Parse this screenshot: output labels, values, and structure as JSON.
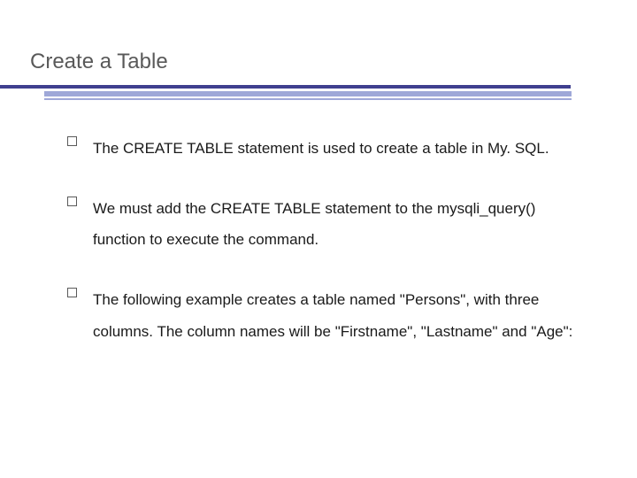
{
  "slide": {
    "title": "Create a Table",
    "bullets": [
      "The CREATE TABLE statement is used to create a table in My. SQL.",
      "We must add the CREATE TABLE statement to the mysqli_query() function to execute the command.",
      "The following example creates a table named \"Persons\", with three columns. The column names will be \"Firstname\", \"Lastname\" and \"Age\":"
    ]
  }
}
